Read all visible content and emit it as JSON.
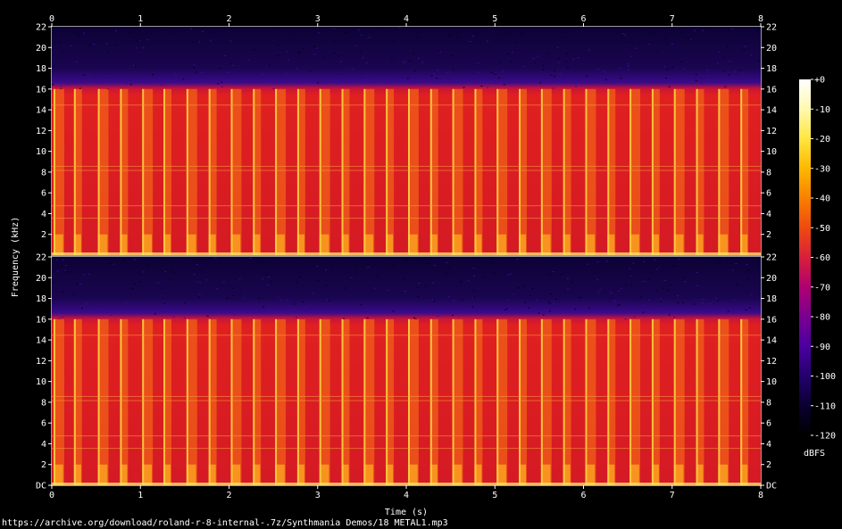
{
  "chart_data": {
    "type": "heatmap",
    "xlabel": "Time (s)",
    "ylabel": "Frequency (kHz)",
    "x_ticks": [
      "0",
      "1",
      "2",
      "3",
      "4",
      "5",
      "6",
      "7",
      "8"
    ],
    "xlim": [
      0,
      8
    ],
    "channels": [
      {
        "y_ticks": [
          "DC",
          "2",
          "4",
          "6",
          "8",
          "10",
          "12",
          "14",
          "16",
          "18",
          "20",
          "22"
        ]
      },
      {
        "y_ticks": [
          "DC",
          "2",
          "4",
          "6",
          "8",
          "10",
          "12",
          "14",
          "16",
          "18",
          "20",
          "22"
        ]
      }
    ],
    "y_ticks_top_panel": [
      "2",
      "4",
      "6",
      "8",
      "10",
      "12",
      "14",
      "16",
      "18",
      "20",
      "22"
    ],
    "ylim_khz": [
      0,
      22
    ],
    "bandwidth_cutoff_khz": 16,
    "colorbar": {
      "label": "dBFS",
      "ticks": [
        "+0",
        "-10",
        "-20",
        "-30",
        "-40",
        "-50",
        "-60",
        "-70",
        "-80",
        "-90",
        "-100",
        "-110",
        "-120"
      ],
      "range": [
        -120,
        0
      ],
      "colors": [
        "#000000",
        "#0a0030",
        "#24006e",
        "#4a00a0",
        "#7a0090",
        "#b00070",
        "#d8203a",
        "#ef4a10",
        "#f98000",
        "#fdb800",
        "#ffe640",
        "#fff8b0",
        "#ffffff"
      ]
    },
    "bursts_start_s": [
      0.02,
      0.25,
      0.52,
      0.77,
      1.02,
      1.26,
      1.52,
      1.77,
      2.02,
      2.27,
      2.52,
      2.77,
      3.02,
      3.27,
      3.52,
      3.77,
      4.02,
      4.27,
      4.52,
      4.77,
      5.02,
      5.27,
      5.52,
      5.77,
      6.02,
      6.27,
      6.52,
      6.77,
      7.02,
      7.27,
      7.52,
      7.77
    ]
  },
  "footer": {
    "source_url": "https://archive.org/download/roland-r-8-internal-.7z/Synthmania Demos/18 METAL1.mp3"
  }
}
